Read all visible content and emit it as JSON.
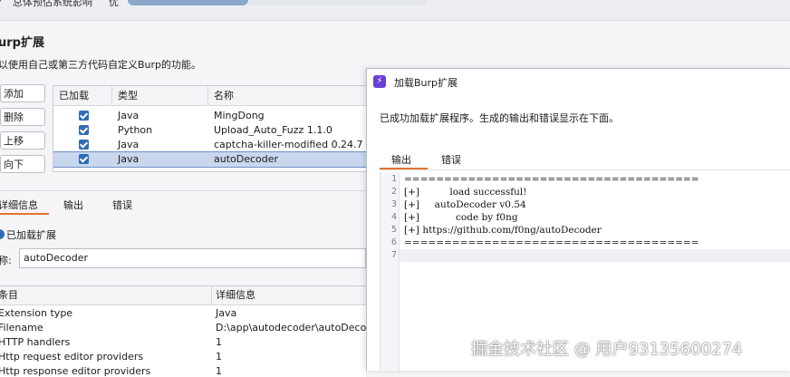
{
  "top": {
    "prefix": "⁄",
    "title": "总体预估系统影响",
    "mid": "优"
  },
  "extensions": {
    "heading": "urp扩展",
    "description": "以使用自己或第三方代码自定义Burp的功能。",
    "buttons": {
      "add": "添加",
      "remove": "删除",
      "up": "上移",
      "down": "向下"
    },
    "columns": {
      "loaded": "已加载",
      "type": "类型",
      "name": "名称"
    },
    "rows": [
      {
        "type": "Java",
        "name": "MingDong"
      },
      {
        "type": "Python",
        "name": "Upload_Auto_Fuzz 1.1.0"
      },
      {
        "type": "Java",
        "name": "captcha-killer-modified 0.24.7"
      },
      {
        "type": "Java",
        "name": "autoDecoder"
      }
    ]
  },
  "details": {
    "tabs": {
      "details": "详细信息",
      "output": "输出",
      "errors": "错误"
    },
    "loaded_label": "已加载扩展",
    "name_label": "称:",
    "name_value": "autoDecoder",
    "table_headers": {
      "item": "条目",
      "detail": "详细信息"
    },
    "rows": [
      {
        "item": "Extension type",
        "value": "Java"
      },
      {
        "item": "Filename",
        "value": "D:\\app\\autodecoder\\autoDeco"
      },
      {
        "item": "HTTP handlers",
        "value": "1"
      },
      {
        "item": "Http request editor providers",
        "value": "1"
      },
      {
        "item": "Http response editor providers",
        "value": "1"
      }
    ]
  },
  "dialog": {
    "title": "加载Burp扩展",
    "message": "已成功加载扩展程序。生成的输出和错误显示在下面。",
    "tabs": {
      "output": "输出",
      "errors": "错误"
    },
    "lines": [
      "=====================================",
      "[+]          load successful!",
      "[+]     autoDecoder v0.54",
      "[+]            code by f0ng",
      "[+] https://github.com/f0ng/autoDecoder",
      "=====================================",
      ""
    ],
    "line_numbers": [
      "1",
      "2",
      "3",
      "4",
      "5",
      "6",
      "7"
    ]
  },
  "watermark": "掘金技术社区 @ 用户93135600274",
  "colors": {
    "accent": "#e4732c",
    "checkbox": "#2f6db4",
    "selection": "#c9d7ee",
    "dialog_icon": "#6a3fd6"
  }
}
